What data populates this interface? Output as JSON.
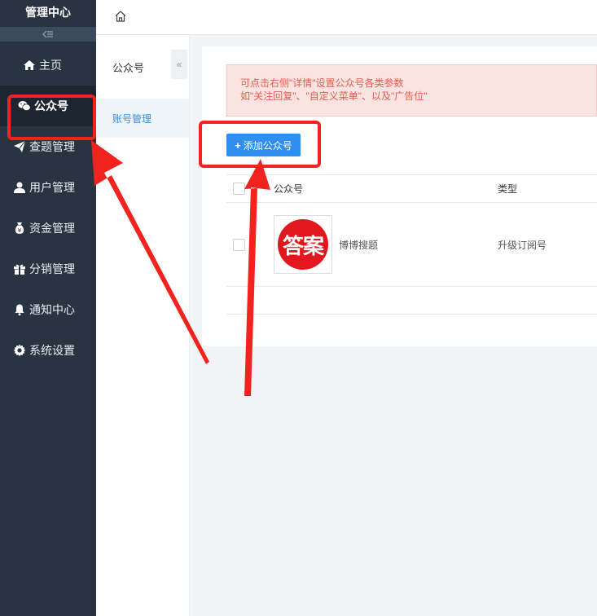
{
  "sidebar": {
    "brand": "管理中心",
    "items": [
      {
        "label": "主页",
        "icon": "home-icon"
      },
      {
        "label": "公众号",
        "icon": "wechat-icon"
      },
      {
        "label": "查题管理",
        "icon": "send-icon"
      },
      {
        "label": "用户管理",
        "icon": "user-icon"
      },
      {
        "label": "资金管理",
        "icon": "money-bag-icon"
      },
      {
        "label": "分销管理",
        "icon": "gift-icon"
      },
      {
        "label": "通知中心",
        "icon": "bell-icon"
      },
      {
        "label": "系统设置",
        "icon": "gear-icon"
      }
    ],
    "active_index": 1
  },
  "subnav": {
    "title": "公众号",
    "items": [
      {
        "label": "账号管理"
      }
    ]
  },
  "notice": {
    "line1": "可点击右侧\"详情\"设置公众号各类参数",
    "line2": "如\"关注回复\"、\"自定义菜单\"、以及\"广告位\""
  },
  "add_button": {
    "label": "添加公众号"
  },
  "table": {
    "headers": {
      "name": "公众号",
      "type": "类型"
    },
    "rows": [
      {
        "avatar_text": "答案",
        "name": "博博搜题",
        "type": "升级订阅号"
      }
    ]
  },
  "colors": {
    "sidebar_bg": "#283442",
    "accent": "#2f8ff0",
    "annotation_red": "#f2231e"
  }
}
